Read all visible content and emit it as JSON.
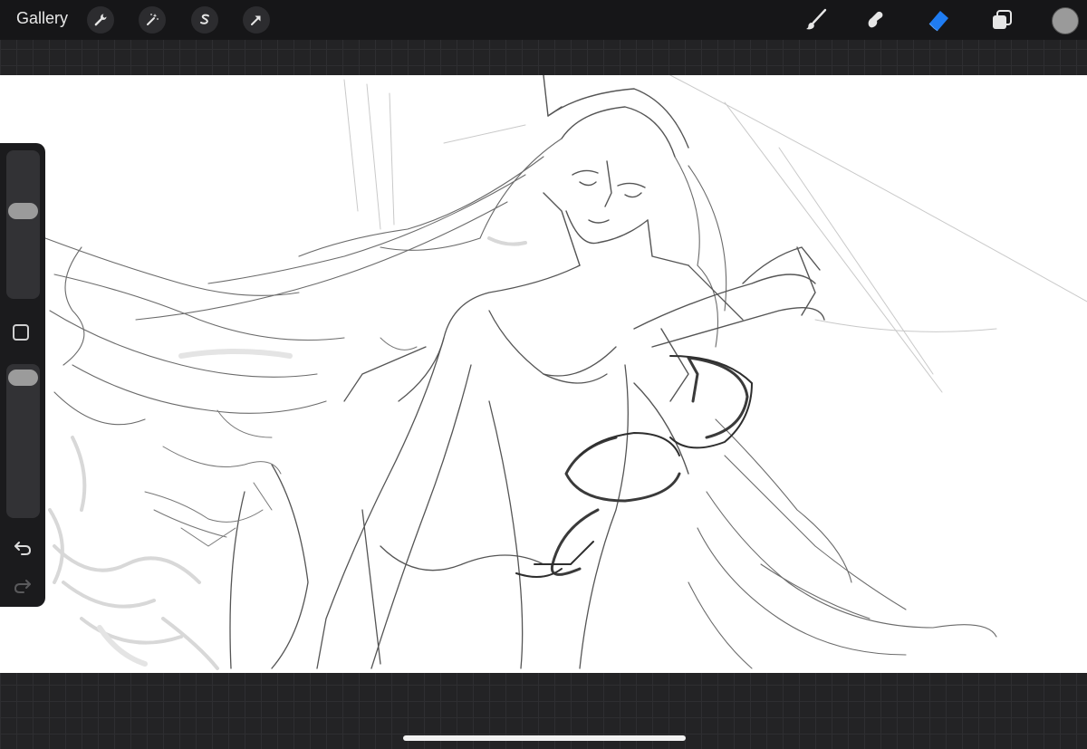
{
  "topbar": {
    "gallery_label": "Gallery",
    "actions": [
      {
        "icon": "wrench-icon",
        "name": "actions-button"
      },
      {
        "icon": "magic-wand-icon",
        "name": "adjustments-button"
      },
      {
        "icon": "selection-s-icon",
        "name": "selection-button"
      },
      {
        "icon": "arrow-cursor-icon",
        "name": "transform-button"
      }
    ],
    "tools": [
      {
        "icon": "brush-icon",
        "name": "paint-tool-button",
        "active": false
      },
      {
        "icon": "smudge-icon",
        "name": "smudge-tool-button",
        "active": false
      },
      {
        "icon": "eraser-icon",
        "name": "eraser-tool-button",
        "active": true
      },
      {
        "icon": "layers-icon",
        "name": "layers-button",
        "active": false
      }
    ],
    "current_color": "#9a9a9a"
  },
  "sidebar": {
    "brush_size_level": 0.35,
    "opacity_level": 0.05,
    "modify_button_icon": "square-icon",
    "undo_icon": "undo-arrow-icon",
    "redo_icon": "redo-arrow-icon"
  },
  "colors": {
    "active_tool": "#1f7cf2",
    "topbar_bg": "#161618",
    "canvas_bg": "#ffffff",
    "sketch_stroke": "#4a4a4a"
  }
}
